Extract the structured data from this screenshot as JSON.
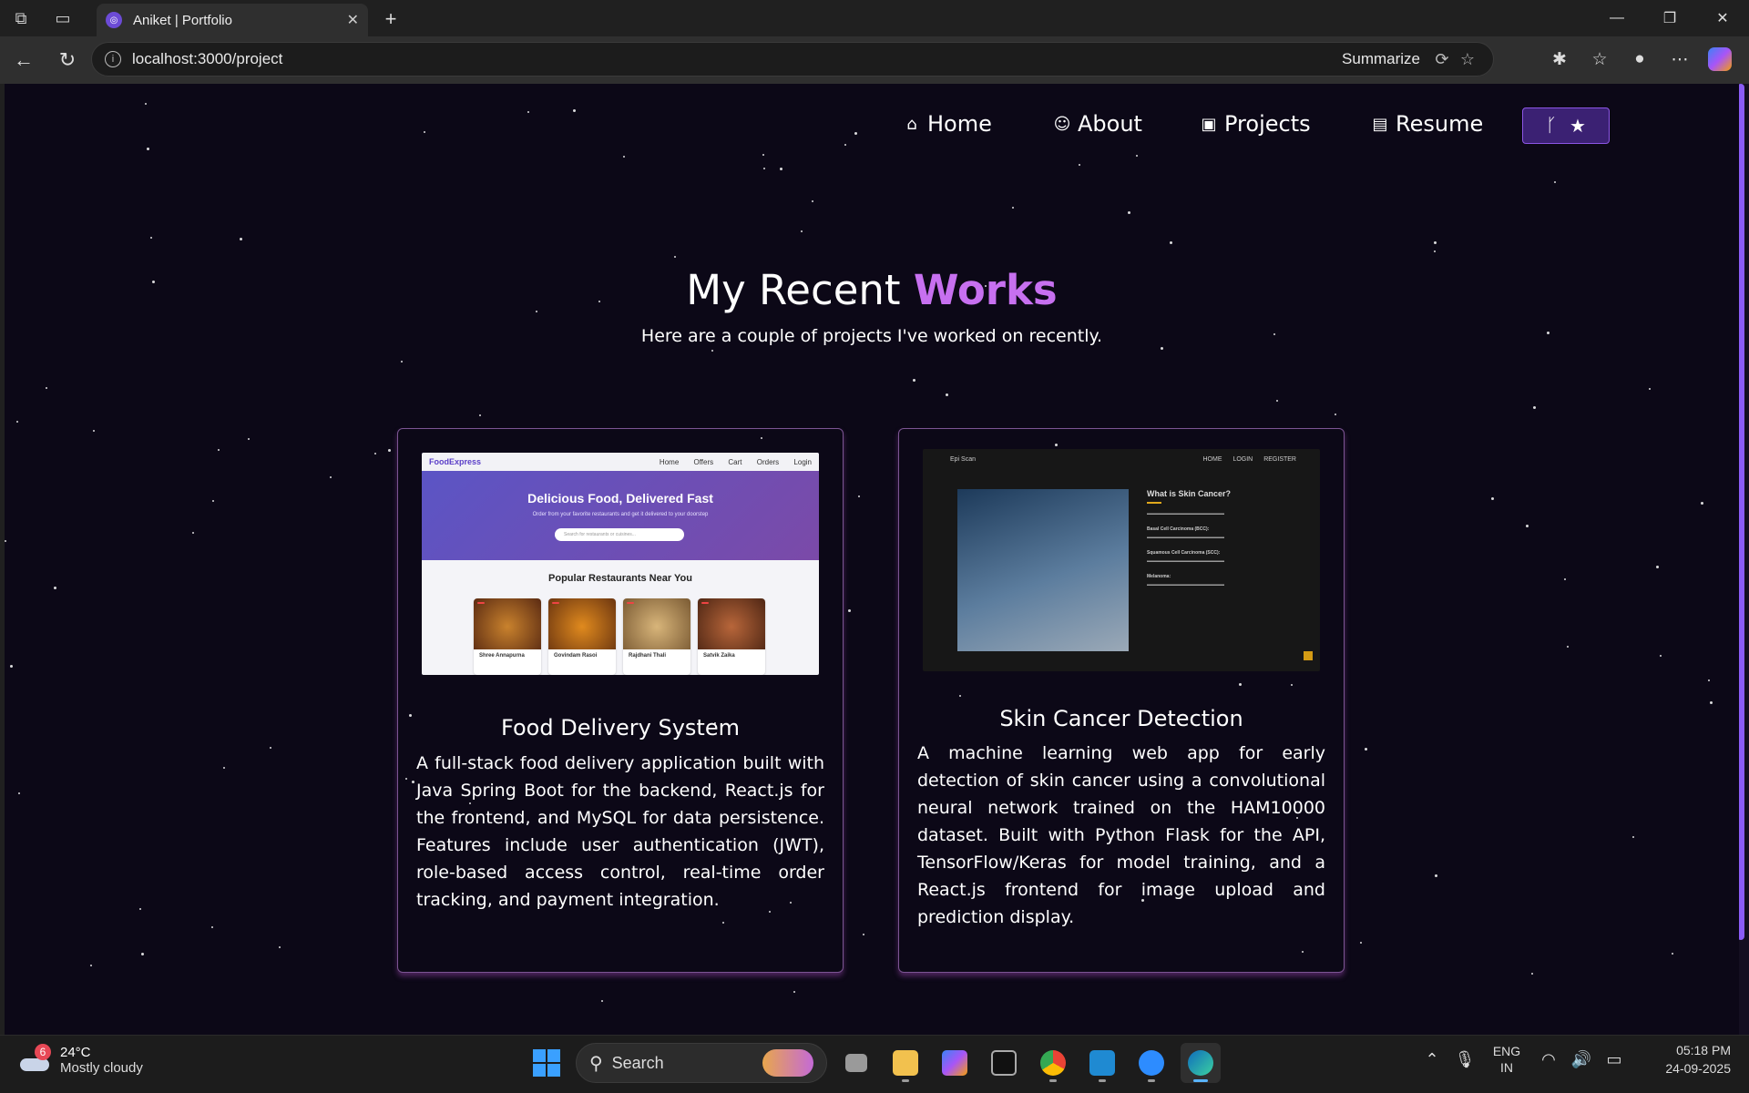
{
  "browser": {
    "tab_title": "Aniket | Portfolio",
    "url": "localhost:3000/project",
    "summarize_label": "Summarize"
  },
  "site": {
    "nav": [
      {
        "label": "Home",
        "icon": "home-icon"
      },
      {
        "label": "About",
        "icon": "user-icon"
      },
      {
        "label": "Projects",
        "icon": "presentation-icon"
      },
      {
        "label": "Resume",
        "icon": "document-icon"
      }
    ],
    "github_button_icons": [
      "git-fork-icon",
      "star-icon"
    ],
    "heading_main": "My Recent ",
    "heading_accent": "Works",
    "subheading": "Here are a couple of projects I've worked on recently.",
    "accent_color": "#c770f0",
    "projects": [
      {
        "title": "Food Delivery System",
        "description": "A full-stack food delivery application built with Java Spring Boot for the backend, React.js for the frontend, and MySQL for data persistence. Features include user authentication (JWT), role-based access control, real-time order tracking, and payment integration.",
        "preview": {
          "logo": "FoodExpress",
          "nav_links": [
            "Home",
            "Offers",
            "Cart",
            "Orders",
            "Login"
          ],
          "hero_title": "Delicious Food, Delivered Fast",
          "hero_text": "Order from your favorite restaurants and get it delivered to your doorstep",
          "search_placeholder": "Search for restaurants or cuisines...",
          "section_title": "Popular Restaurants Near You",
          "restaurants": [
            "Shree Annapurna",
            "Govindam Rasoi",
            "Rajdhani Thali",
            "Satvik Zaika"
          ]
        }
      },
      {
        "title": "Skin Cancer Detection",
        "description": "A machine learning web app for early detection of skin cancer using a convolutional neural network trained on the HAM10000 dataset. Built with Python Flask for the API, TensorFlow/Keras for model training, and a React.js frontend for image upload and prediction display.",
        "preview": {
          "logo": "Epi Scan",
          "nav_links": [
            "HOME",
            "LOGIN",
            "REGISTER"
          ],
          "title": "What is Skin Cancer?",
          "sections": [
            "Basal Cell Carcinoma (BCC):",
            "Squamous Cell Carcinoma (SCC):",
            "Melanoma:"
          ]
        }
      }
    ]
  },
  "taskbar": {
    "weather_badge": "6",
    "temperature": "24°C",
    "condition": "Mostly cloudy",
    "search_label": "Search",
    "language_top": "ENG",
    "language_bottom": "IN",
    "time": "05:18 PM",
    "date": "24-09-2025"
  }
}
